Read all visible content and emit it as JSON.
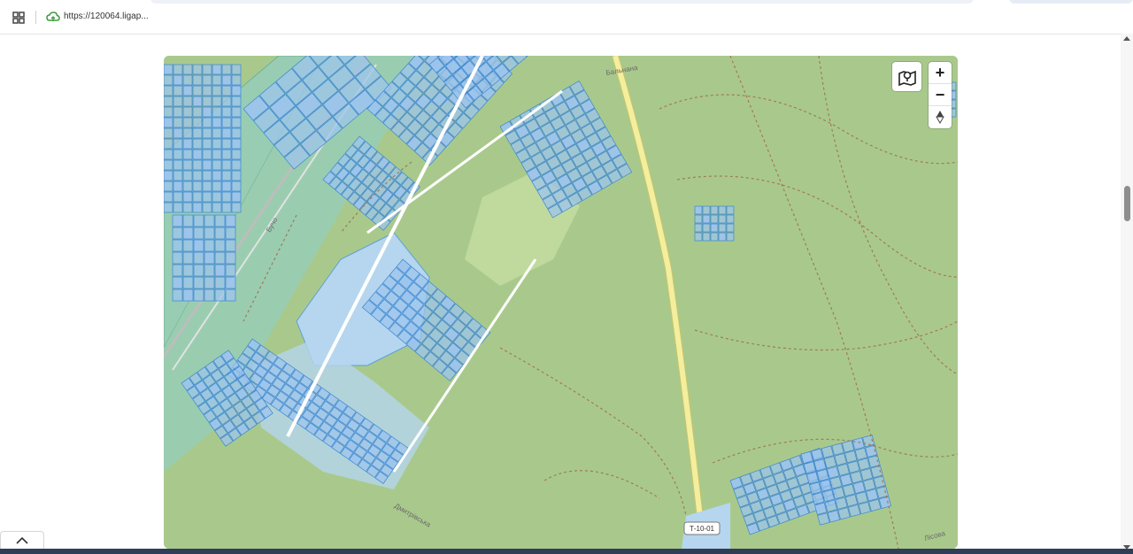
{
  "browser": {
    "url_display": "https://120064.ligap...",
    "apps_icon": "apps-grid-icon",
    "url_icon": "cloud-icon"
  },
  "map": {
    "controls": {
      "map_icon": "map-location-icon",
      "zoom_in_label": "+",
      "zoom_out_label": "−",
      "reset_north_label": "compass-icon"
    },
    "road_labels": {
      "road_badge": "Т-10-01",
      "road_label_a": "Бучо",
      "road_label_b": "Дмитрівська",
      "road_label_c": "Бальнана",
      "road_label_d": "Лісова"
    },
    "colors": {
      "forest": "#a9c98c",
      "parcel_fill": "#9dc4ec",
      "parcel_stroke": "#3a86d0",
      "road_main": "#f3ef9e",
      "water": "#b5d6ee",
      "meadow": "#98cdb3"
    }
  },
  "footer": {
    "collapse_icon": "chevron-up-icon"
  }
}
